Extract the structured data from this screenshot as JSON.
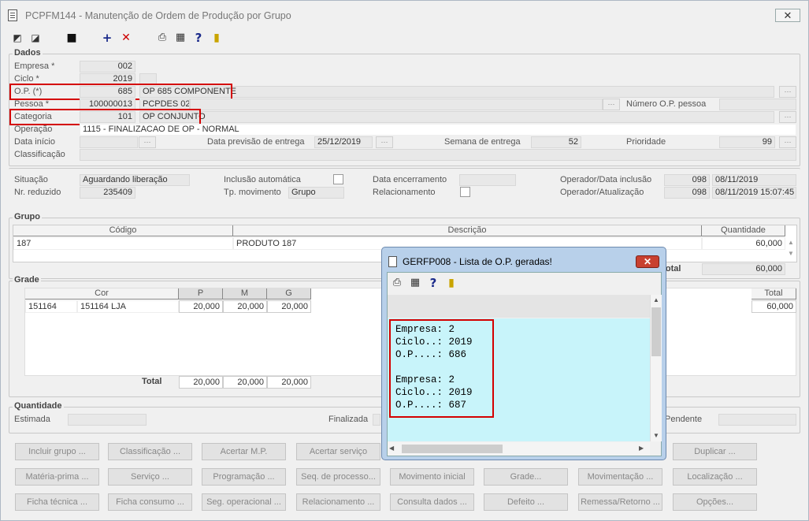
{
  "window": {
    "title": "PCPFM144 - Manutenção de Ordem de Produção por Grupo",
    "close": "✕"
  },
  "toolbar": [
    "nav-first-icon",
    "nav-back-icon",
    "save-icon",
    "add-icon",
    "delete-icon",
    "print-icon",
    "calendar-icon",
    "help-icon",
    "exit-door-icon"
  ],
  "dados": {
    "title": "Dados",
    "empresa": {
      "label": "Empresa *",
      "value": "002"
    },
    "ciclo": {
      "label": "Ciclo *",
      "value": "2019"
    },
    "op": {
      "label": "O.P. (*)",
      "value": "685",
      "desc": "OP 685 COMPONENTE"
    },
    "pessoa": {
      "label": "Pessoa *",
      "value": "100000013",
      "desc": "PCPDES 02"
    },
    "numero_op_pessoa": {
      "label": "Número O.P. pessoa",
      "value": ""
    },
    "categoria": {
      "label": "Categoria",
      "value": "101",
      "desc": "OP CONJUNTO"
    },
    "operacao": {
      "label": "Operação",
      "value": "1115 - FINALIZACAO DE OP - NORMAL"
    },
    "data_inicio": {
      "label": "Data início",
      "value": ""
    },
    "data_previsao": {
      "label": "Data previsão de entrega",
      "value": "25/12/2019"
    },
    "semana": {
      "label": "Semana de entrega",
      "value": "52"
    },
    "prioridade": {
      "label": "Prioridade",
      "value": "99"
    },
    "classificacao": {
      "label": "Classificação",
      "value": ""
    }
  },
  "status": {
    "situacao": {
      "label": "Situação",
      "value": "Aguardando liberação"
    },
    "nr_reduzido": {
      "label": "Nr. reduzido",
      "value": "235409"
    },
    "inclusao_automatica": {
      "label": "Inclusão automática",
      "checked": false
    },
    "tp_movimento": {
      "label": "Tp. movimento",
      "value": "Grupo"
    },
    "data_encerramento": {
      "label": "Data encerramento",
      "value": ""
    },
    "relacionamento": {
      "label": "Relacionamento",
      "checked": false
    },
    "operador_inclusao": {
      "label": "Operador/Data inclusão",
      "operador": "098",
      "data": "08/11/2019"
    },
    "operador_atualizacao": {
      "label": "Operador/Atualização",
      "operador": "098",
      "data": "08/11/2019 15:07:45"
    }
  },
  "grupo": {
    "title": "Grupo",
    "headers": {
      "codigo": "Código",
      "descricao": "Descrição",
      "quantidade": "Quantidade"
    },
    "row": {
      "codigo": "187",
      "descricao": "PRODUTO 187",
      "quantidade": "60,000"
    },
    "total_label": "Total",
    "total_value": "60,000"
  },
  "grade": {
    "title": "Grade",
    "headers": {
      "cor": "Cor",
      "p": "P",
      "m": "M",
      "g": "G",
      "total": "Total"
    },
    "row": {
      "cor_code": "151164",
      "cor_desc": "151164 LJA",
      "p": "20,000",
      "m": "20,000",
      "g": "20,000",
      "total": "60,000"
    },
    "total_label": "Total",
    "totals": {
      "p": "20,000",
      "m": "20,000",
      "g": "20,000"
    }
  },
  "quantidade": {
    "title": "Quantidade",
    "estimada": {
      "label": "Estimada",
      "value": ""
    },
    "finalizada": {
      "label": "Finalizada",
      "value": ""
    },
    "pendente": {
      "label": "Pendente",
      "value": ""
    }
  },
  "buttons": {
    "row1": [
      "Incluir grupo ...",
      "Classificação ...",
      "Acertar M.P.",
      "Acertar serviço",
      "",
      "",
      "",
      "Duplicar ..."
    ],
    "row2": [
      "Matéria-prima ...",
      "Serviço ...",
      "Programação ...",
      "Seq. de processo...",
      "Movimento inicial",
      "Grade...",
      "Movimentação ...",
      "Localização ..."
    ],
    "row3": [
      "Ficha técnica ...",
      "Ficha consumo ...",
      "Seg. operacional ...",
      "Relacionamento ...",
      "Consulta dados ...",
      "Defeito ...",
      "Remessa/Retorno ...",
      "Opções..."
    ]
  },
  "dialog": {
    "title": "GERFP008 - Lista de O.P. geradas!",
    "close": "✕",
    "lines": [
      "Empresa: 2",
      "Ciclo..: 2019",
      "O.P....: 686",
      "",
      "Empresa: 2",
      "Ciclo..: 2019",
      "O.P....: 687"
    ]
  }
}
